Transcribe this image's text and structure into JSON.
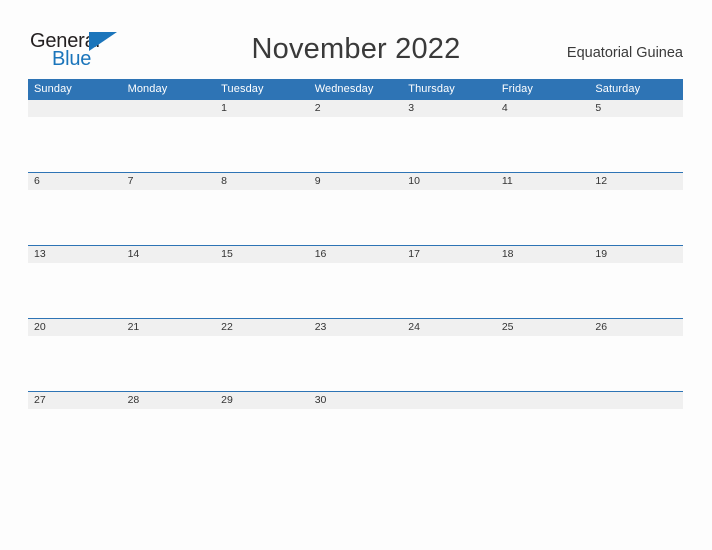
{
  "logo": {
    "word_top": "General",
    "word_bottom": "Blue",
    "flag_icon": "triangle-flag-icon",
    "color_dark": "#231f20",
    "color_blue": "#1b75bb"
  },
  "header": {
    "title": "November 2022",
    "region": "Equatorial Guinea"
  },
  "colors": {
    "header_blue": "#2e74b5",
    "row_band_gray": "#f0f0f0",
    "page_background": "#fdfdfd",
    "text_dark": "#3a3a3a"
  },
  "calendar": {
    "weekday_headers": [
      "Sunday",
      "Monday",
      "Tuesday",
      "Wednesday",
      "Thursday",
      "Friday",
      "Saturday"
    ],
    "weeks": [
      [
        "",
        "",
        "1",
        "2",
        "3",
        "4",
        "5"
      ],
      [
        "6",
        "7",
        "8",
        "9",
        "10",
        "11",
        "12"
      ],
      [
        "13",
        "14",
        "15",
        "16",
        "17",
        "18",
        "19"
      ],
      [
        "20",
        "21",
        "22",
        "23",
        "24",
        "25",
        "26"
      ],
      [
        "27",
        "28",
        "29",
        "30",
        "",
        "",
        ""
      ]
    ]
  }
}
